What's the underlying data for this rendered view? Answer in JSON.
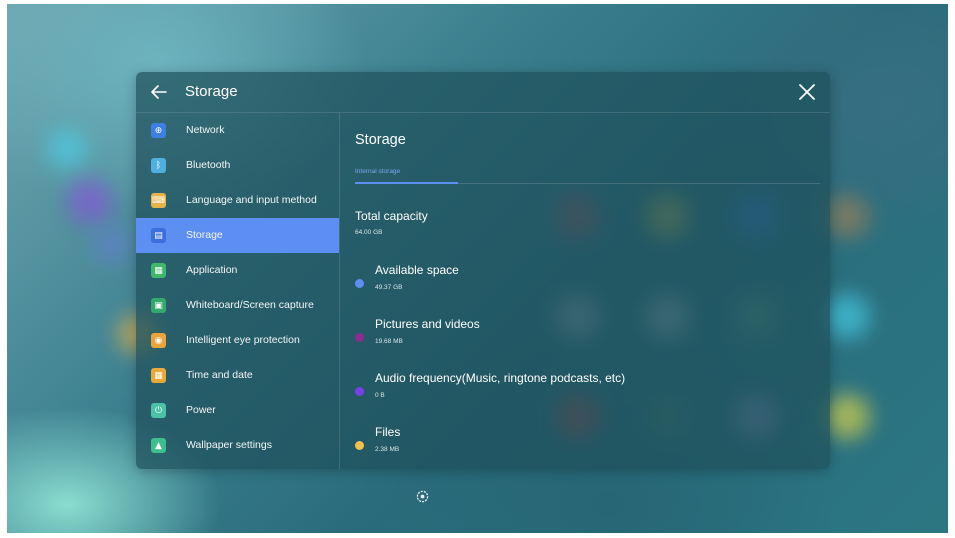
{
  "header": {
    "title": "Storage"
  },
  "sidebar": {
    "items": [
      {
        "label": "Network",
        "icon": "globe-icon",
        "color": "#3d7fe3",
        "glyph": "⊕"
      },
      {
        "label": "Bluetooth",
        "icon": "bluetooth-icon",
        "color": "#4fb0e0",
        "glyph": "ᛒ"
      },
      {
        "label": "Language and input method",
        "icon": "keyboard-icon",
        "color": "#e8b24a",
        "glyph": "⌨"
      },
      {
        "label": "Storage",
        "icon": "storage-icon",
        "color": "#3b6fd9",
        "glyph": "▤",
        "active": true
      },
      {
        "label": "Application",
        "icon": "apps-icon",
        "color": "#3fb86b",
        "glyph": "▦"
      },
      {
        "label": "Whiteboard/Screen capture",
        "icon": "whiteboard-icon",
        "color": "#35a86c",
        "glyph": "▣"
      },
      {
        "label": "Intelligent eye protection",
        "icon": "eye-icon",
        "color": "#e9a43c",
        "glyph": "◉"
      },
      {
        "label": "Time and date",
        "icon": "calendar-icon",
        "color": "#e8a93a",
        "glyph": "▦"
      },
      {
        "label": "Power",
        "icon": "power-icon",
        "color": "#4bc2a6",
        "glyph": "⏻"
      },
      {
        "label": "Wallpaper settings",
        "icon": "wallpaper-icon",
        "color": "#3cbf8d",
        "glyph": "▲"
      }
    ]
  },
  "content": {
    "title": "Storage",
    "tab_label": "Internal storage",
    "total_capacity_label": "Total capacity",
    "total_capacity_value": "64.00 GB",
    "rows": [
      {
        "label": "Available space",
        "value": "49.37 GB",
        "color": "#5d8ef1"
      },
      {
        "label": "Pictures and videos",
        "value": "19.68 MB",
        "color": "#8c2c8c"
      },
      {
        "label": "Audio frequency(Music, ringtone podcasts, etc)",
        "value": "0 B",
        "color": "#7a3fe8"
      },
      {
        "label": "Files",
        "value": "2.38 MB",
        "color": "#f0c14b"
      }
    ]
  },
  "colors": {
    "accent": "#5d8ef1",
    "panel": "#1e505c"
  }
}
